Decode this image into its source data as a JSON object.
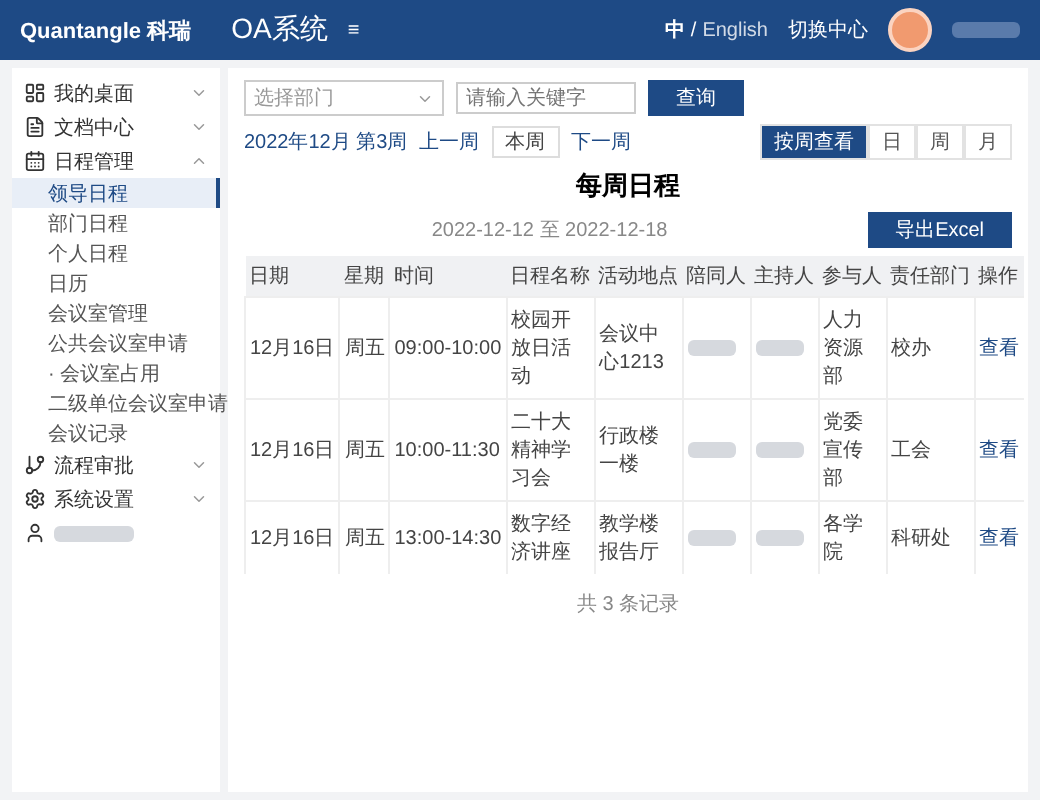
{
  "header": {
    "logo": "Quantangle",
    "logo_suffix": "科瑞",
    "title": "OA系统",
    "menu_glyph": "≡",
    "languages": [
      {
        "label": "中",
        "selected": true
      },
      {
        "label": "English",
        "selected": false
      }
    ],
    "language_separator": "/",
    "switch_link": "切换中心",
    "user_redacted": true
  },
  "sidebar": {
    "items": [
      {
        "kind": "menu",
        "label": "我的桌面",
        "expanded": false
      },
      {
        "kind": "menu",
        "label": "文档中心",
        "expanded": false
      },
      {
        "kind": "menu",
        "label": "日程管理",
        "expanded": true,
        "children": [
          {
            "label": "领导日程",
            "selected": true
          },
          {
            "label": "部门日程",
            "selected": false
          },
          {
            "label": "个人日程",
            "selected": false
          },
          {
            "label": "日历",
            "selected": false
          },
          {
            "label": "会议室管理",
            "selected": false
          },
          {
            "label": "公共会议室申请",
            "selected": false
          },
          {
            "label": "· 会议室占用",
            "selected": false
          },
          {
            "label": "二级单位会议室申请",
            "selected": false
          },
          {
            "label": "会议记录",
            "selected": false
          }
        ]
      },
      {
        "kind": "menu",
        "label": "流程审批",
        "expanded": false
      },
      {
        "kind": "menu",
        "label": "系统设置",
        "expanded": false
      },
      {
        "kind": "redacted"
      }
    ]
  },
  "filters": {
    "department": {
      "placeholder": "选择部门"
    },
    "keyword": {
      "placeholder": "请输入关键字"
    },
    "search_button": "查询"
  },
  "week_nav": {
    "current": "2022年12月 第3周",
    "prev": "上一周",
    "this": "本周",
    "next": "下一周"
  },
  "views": [
    {
      "label": "按周查看",
      "selected": true
    },
    {
      "label": "日",
      "selected": false
    },
    {
      "label": "周",
      "selected": false
    },
    {
      "label": "月",
      "selected": false
    }
  ],
  "schedule": {
    "title": "每周日程",
    "range": "2022-12-12 至 2022-12-18",
    "export_button": "导出Excel",
    "columns": [
      "日期",
      "星期",
      "时间",
      "日程名称",
      "活动地点",
      "陪同人",
      "主持人",
      "参与人",
      "责任部门",
      "操作"
    ],
    "rows": [
      {
        "date": "12月16日",
        "weekday": "周五",
        "time": "09:00-10:00",
        "name": "校园开放日活动",
        "place": "会议中心1213",
        "companion_redacted": true,
        "host_redacted": true,
        "participants": "人力资源部",
        "department": "校办",
        "action": "查看"
      },
      {
        "date": "12月16日",
        "weekday": "周五",
        "time": "10:00-11:30",
        "name": "二十大精神学习会",
        "place": "行政楼一楼",
        "companion_redacted": true,
        "host_redacted": true,
        "participants": "党委宣传部",
        "department": "工会",
        "action": "查看"
      },
      {
        "date": "12月16日",
        "weekday": "周五",
        "time": "13:00-14:30",
        "name": "数字经济讲座",
        "place": "教学楼报告厅",
        "companion_redacted": true,
        "host_redacted": true,
        "participants": "各学院",
        "department": "科研处",
        "action": "查看"
      }
    ],
    "footer": "共 3 条记录"
  }
}
